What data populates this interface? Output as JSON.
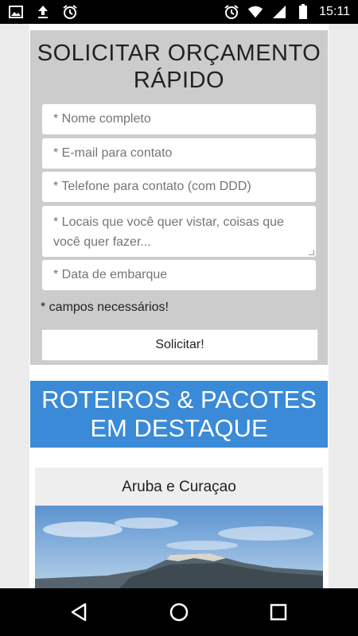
{
  "status_bar": {
    "time": "15:11",
    "left_icons": [
      "image-icon",
      "upload-icon",
      "alarm-icon"
    ],
    "right_icons": [
      "alarm-icon",
      "wifi-icon",
      "signal-icon",
      "battery-icon"
    ]
  },
  "quote_form": {
    "title": "SOLICITAR ORÇAMENTO RÁPIDO",
    "fields": {
      "name_placeholder": "* Nome completo",
      "email_placeholder": "* E-mail para contato",
      "phone_placeholder": "* Telefone para contato (com DDD)",
      "places_placeholder": "* Locais que você quer vistar, coisas que você quer fazer...",
      "date_placeholder": "* Data de embarque"
    },
    "required_note": "* campos necessários!",
    "submit_label": "Solicitar!"
  },
  "featured": {
    "title": "ROTEIROS & PACOTES EM DESTAQUE",
    "cards": [
      {
        "title": "Aruba e Curaçao"
      }
    ]
  },
  "colors": {
    "form_bg": "#cccccc",
    "banner_bg": "#3a8ad8",
    "page_bg": "#ececec"
  }
}
